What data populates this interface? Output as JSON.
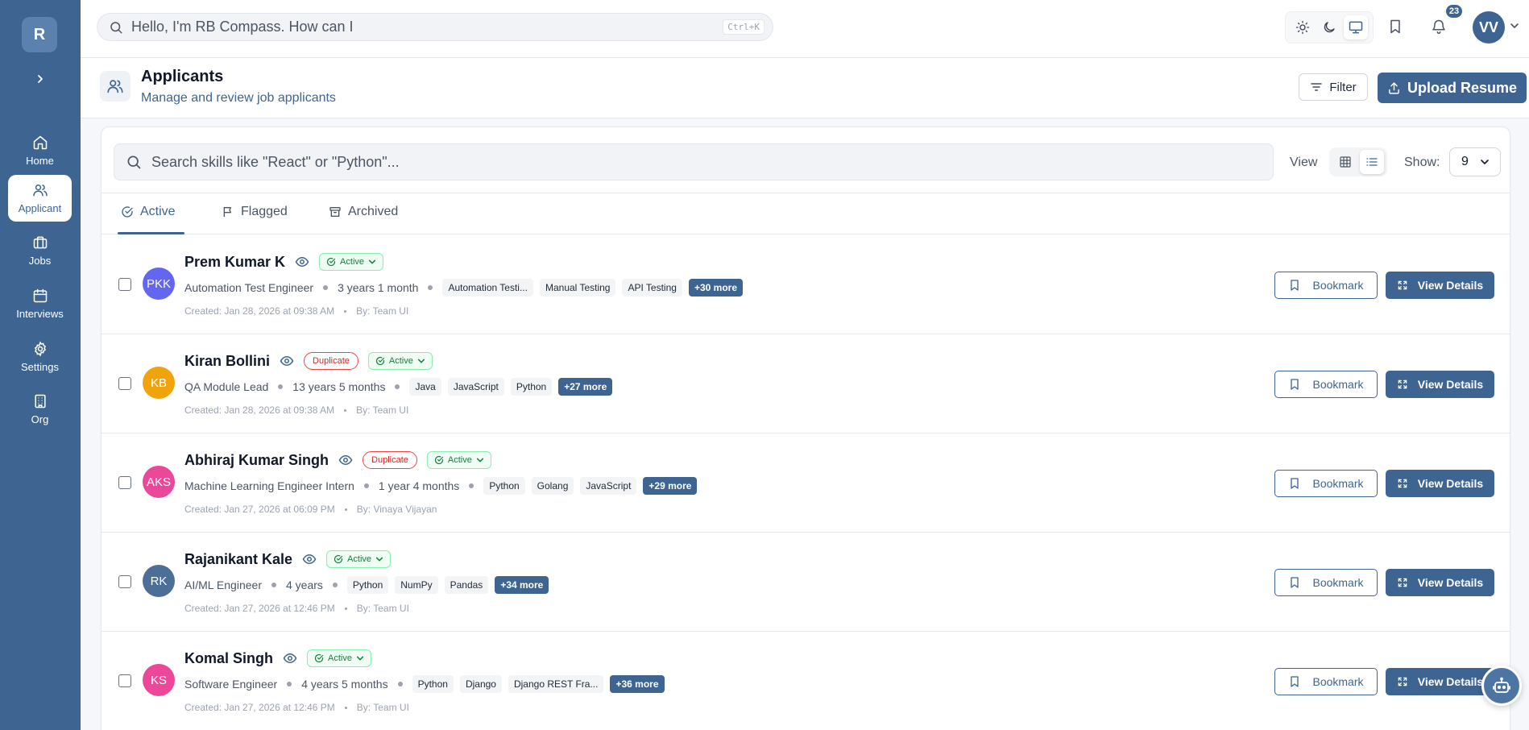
{
  "app": {
    "logo_letter": "R"
  },
  "sidebar": {
    "items": [
      {
        "label": "Home",
        "icon": "home-icon"
      },
      {
        "label": "Applicant",
        "icon": "users-icon",
        "active": true
      },
      {
        "label": "Jobs",
        "icon": "briefcase-icon"
      },
      {
        "label": "Interviews",
        "icon": "calendar-icon"
      },
      {
        "label": "Settings",
        "icon": "gear-icon"
      },
      {
        "label": "Org",
        "icon": "building-icon"
      }
    ]
  },
  "topbar": {
    "search_placeholder": "Hello, I'm RB Compass. How can I",
    "search_shortcut": "Ctrl+K",
    "theme_selected": "system",
    "notification_count": "23",
    "user_initials": "VV"
  },
  "page": {
    "title": "Applicants",
    "subtitle": "Manage and review job applicants",
    "filter_label": "Filter",
    "upload_label": "Upload Resume"
  },
  "toolbar": {
    "search_placeholder": "Search skills like \"React\" or \"Python\"...",
    "view_label": "View",
    "view_mode": "list",
    "show_label": "Show:",
    "show_value": "9"
  },
  "tabs": [
    {
      "label": "Active",
      "icon": "check-circle-icon",
      "active": true
    },
    {
      "label": "Flagged",
      "icon": "flag-icon"
    },
    {
      "label": "Archived",
      "icon": "archive-icon"
    }
  ],
  "row_actions": {
    "bookmark": "Bookmark",
    "view_details": "View Details"
  },
  "applicants": [
    {
      "initials": "PKK",
      "avatar_color": "#6366f1",
      "name": "Prem Kumar K",
      "duplicate": null,
      "status": "Active",
      "role": "Automation Test Engineer",
      "experience": "3 years 1 month",
      "skills": [
        "Automation Testi...",
        "Manual Testing",
        "API Testing"
      ],
      "more": "+30 more",
      "created": "Created: Jan 28, 2026 at 09:38 AM",
      "by": "By: Team UI"
    },
    {
      "initials": "KB",
      "avatar_color": "#f0a30a",
      "name": "Kiran Bollini",
      "duplicate": "Duplicate",
      "status": "Active",
      "role": "QA Module Lead",
      "experience": "13 years 5 months",
      "skills": [
        "Java",
        "JavaScript",
        "Python"
      ],
      "more": "+27 more",
      "created": "Created: Jan 28, 2026 at 09:38 AM",
      "by": "By: Team UI"
    },
    {
      "initials": "AKS",
      "avatar_color": "#ec4899",
      "name": "Abhiraj Kumar Singh",
      "duplicate": "Duplicate",
      "status": "Active",
      "role": "Machine Learning Engineer Intern",
      "experience": "1 year 4 months",
      "skills": [
        "Python",
        "Golang",
        "JavaScript"
      ],
      "more": "+29 more",
      "created": "Created: Jan 27, 2026 at 06:09 PM",
      "by": "By: Vinaya Vijayan"
    },
    {
      "initials": "RK",
      "avatar_color": "#4b6f96",
      "name": "Rajanikant Kale",
      "duplicate": null,
      "status": "Active",
      "role": "AI/ML Engineer",
      "experience": "4 years",
      "skills": [
        "Python",
        "NumPy",
        "Pandas"
      ],
      "more": "+34 more",
      "created": "Created: Jan 27, 2026 at 12:46 PM",
      "by": "By: Team UI"
    },
    {
      "initials": "KS",
      "avatar_color": "#ec4899",
      "name": "Komal Singh",
      "duplicate": null,
      "status": "Active",
      "role": "Software Engineer",
      "experience": "4 years 5 months",
      "skills": [
        "Python",
        "Django",
        "Django REST Fra..."
      ],
      "more": "+36 more",
      "created": "Created: Jan 27, 2026 at 12:46 PM",
      "by": "By: Team UI"
    }
  ],
  "assistant": {
    "icon": "bot-icon"
  }
}
